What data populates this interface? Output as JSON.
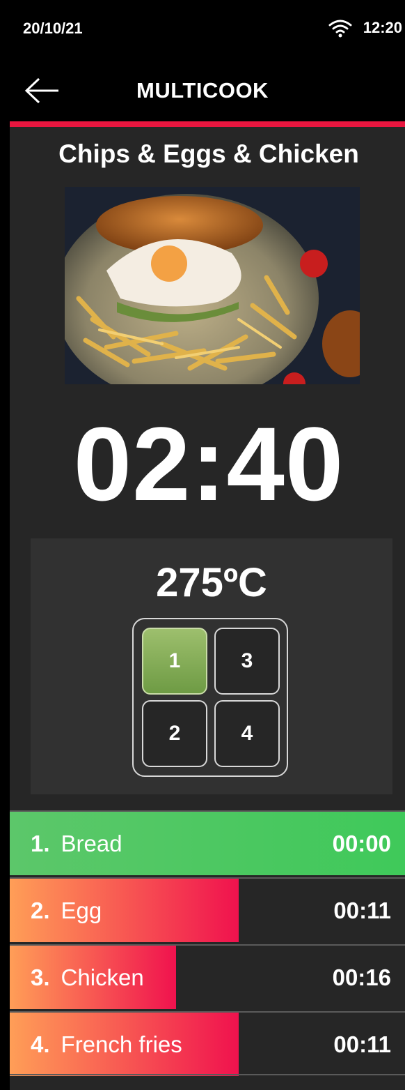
{
  "status": {
    "date": "20/10/21",
    "time": "12:20"
  },
  "header": {
    "title": "MULTICOOK"
  },
  "recipe": {
    "name": "Chips & Eggs & Chicken"
  },
  "timer": {
    "value": "02:40"
  },
  "temperature": {
    "value": "275ºC"
  },
  "trays": [
    {
      "label": "1",
      "active": true
    },
    {
      "label": "3",
      "active": false
    },
    {
      "label": "2",
      "active": false
    },
    {
      "label": "4",
      "active": false
    }
  ],
  "steps": [
    {
      "num": "1.",
      "name": "Bread",
      "time": "00:00",
      "progress": 1.0,
      "state": "done"
    },
    {
      "num": "2.",
      "name": "Egg",
      "time": "00:11",
      "progress": 0.58,
      "state": "running"
    },
    {
      "num": "3.",
      "name": "Chicken",
      "time": "00:16",
      "progress": 0.42,
      "state": "running"
    },
    {
      "num": "4.",
      "name": "French fries",
      "time": "00:11",
      "progress": 0.58,
      "state": "running"
    }
  ],
  "colors": {
    "accent": "#e8163f",
    "done_start": "#5cc76a",
    "done_end": "#3fc95a",
    "progress_start": "#ff9e57",
    "progress_end": "#f0124e",
    "tray_active": "#8ab25a"
  }
}
